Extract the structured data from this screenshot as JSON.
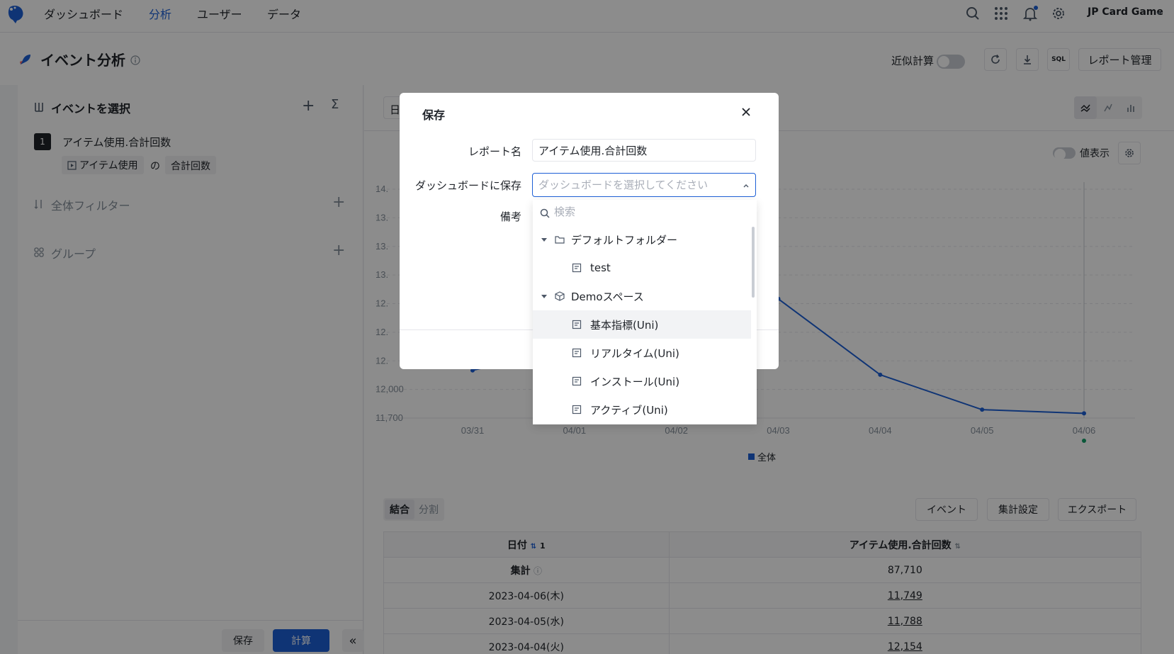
{
  "nav": {
    "items": [
      "ダッシュボード",
      "分析",
      "ユーザー",
      "データ"
    ],
    "active_index": 1,
    "project_name": "JP Card Game"
  },
  "header": {
    "title": "イベント分析",
    "approx_calc_label": "近似計算",
    "sql_label": "SQL",
    "report_mgmt_label": "レポート管理"
  },
  "left_panel": {
    "select_event_title": "イベントを選択",
    "metric_index": "1",
    "metric_name": "アイテム使用.合計回数",
    "metric_event_chip": "アイテム使用",
    "metric_of": "の",
    "metric_measure_chip": "合計回数",
    "global_filter_title": "全体フィルター",
    "group_title": "グループ",
    "save_label": "保存",
    "calc_label": "計算",
    "collapse_label": "«"
  },
  "right_panel": {
    "date_stub": "日",
    "value_display_label": "値表示",
    "legend_label": "全体",
    "combine_tab": "結合",
    "split_tab": "分割",
    "event_btn": "イベント",
    "agg_setting_btn": "集計設定",
    "export_btn": "エクスポート"
  },
  "chart_data": {
    "type": "line",
    "categories": [
      "03/31",
      "04/01",
      "04/02",
      "04/03",
      "04/04",
      "04/05",
      "04/06"
    ],
    "y_tick_labels": [
      "14.",
      "13.",
      "13.",
      "13.",
      "12.",
      "12.",
      "12.",
      "12,000",
      "11,700"
    ],
    "series": [
      {
        "name": "全体",
        "values": [
          12200,
          null,
          null,
          12950,
          12154,
          11788,
          11749
        ]
      }
    ],
    "ylim": [
      11700,
      14100
    ],
    "legend_position": "bottom",
    "color": "#1d5fd6"
  },
  "table": {
    "headers": [
      "日付",
      "アイテム使用.合計回数"
    ],
    "date_sort_badge": "1",
    "summary_label": "集計",
    "summary_value": "87,710",
    "rows": [
      {
        "date": "2023-04-06(木)",
        "value": "11,749"
      },
      {
        "date": "2023-04-05(水)",
        "value": "11,788"
      },
      {
        "date": "2023-04-04(火)",
        "value": "12,154"
      }
    ]
  },
  "modal": {
    "title": "保存",
    "report_name_label": "レポート名",
    "report_name_value": "アイテム使用.合計回数",
    "dashboard_label": "ダッシュボードに保存",
    "dashboard_placeholder": "ダッシュボードを選択してください",
    "note_label": "備考"
  },
  "dropdown": {
    "search_placeholder": "検索",
    "items": [
      {
        "label": "デフォルトフォルダー",
        "kind": "folder",
        "level": 0
      },
      {
        "label": "test",
        "kind": "dashboard",
        "level": 1
      },
      {
        "label": "Demoスペース",
        "kind": "space",
        "level": 0
      },
      {
        "label": "基本指標(Uni)",
        "kind": "dashboard",
        "level": 1
      },
      {
        "label": "リアルタイム(Uni)",
        "kind": "dashboard",
        "level": 1
      },
      {
        "label": "インストール(Uni)",
        "kind": "dashboard",
        "level": 1
      },
      {
        "label": "アクティブ(Uni)",
        "kind": "dashboard",
        "level": 1
      }
    ]
  }
}
